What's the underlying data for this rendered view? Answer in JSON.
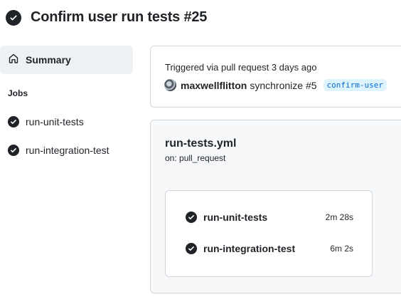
{
  "header": {
    "title_strong": "Confirm user",
    "title_rest": " run tests #25"
  },
  "sidebar": {
    "summary_label": "Summary",
    "jobs_heading": "Jobs",
    "jobs": [
      {
        "label": "run-unit-tests"
      },
      {
        "label": "run-integration-test"
      }
    ]
  },
  "trigger": {
    "text": "Triggered via pull request 3 days ago",
    "user": "maxwellflitton",
    "action": "synchronize #5",
    "branch": "confirm-user"
  },
  "workflow": {
    "name": "run-tests.yml",
    "on": "on: pull_request",
    "jobs": [
      {
        "name": "run-unit-tests",
        "duration": "2m 28s"
      },
      {
        "name": "run-integration-test",
        "duration": "6m 2s"
      }
    ]
  },
  "colors": {
    "success_icon": "#1f2328",
    "branch_text": "#0969da",
    "branch_bg": "#ddf4ff",
    "selected_bg": "#eef1f4"
  },
  "icons": {
    "status": "check-circle-fill-icon",
    "summary": "home-icon",
    "avatar": "user-avatar"
  }
}
